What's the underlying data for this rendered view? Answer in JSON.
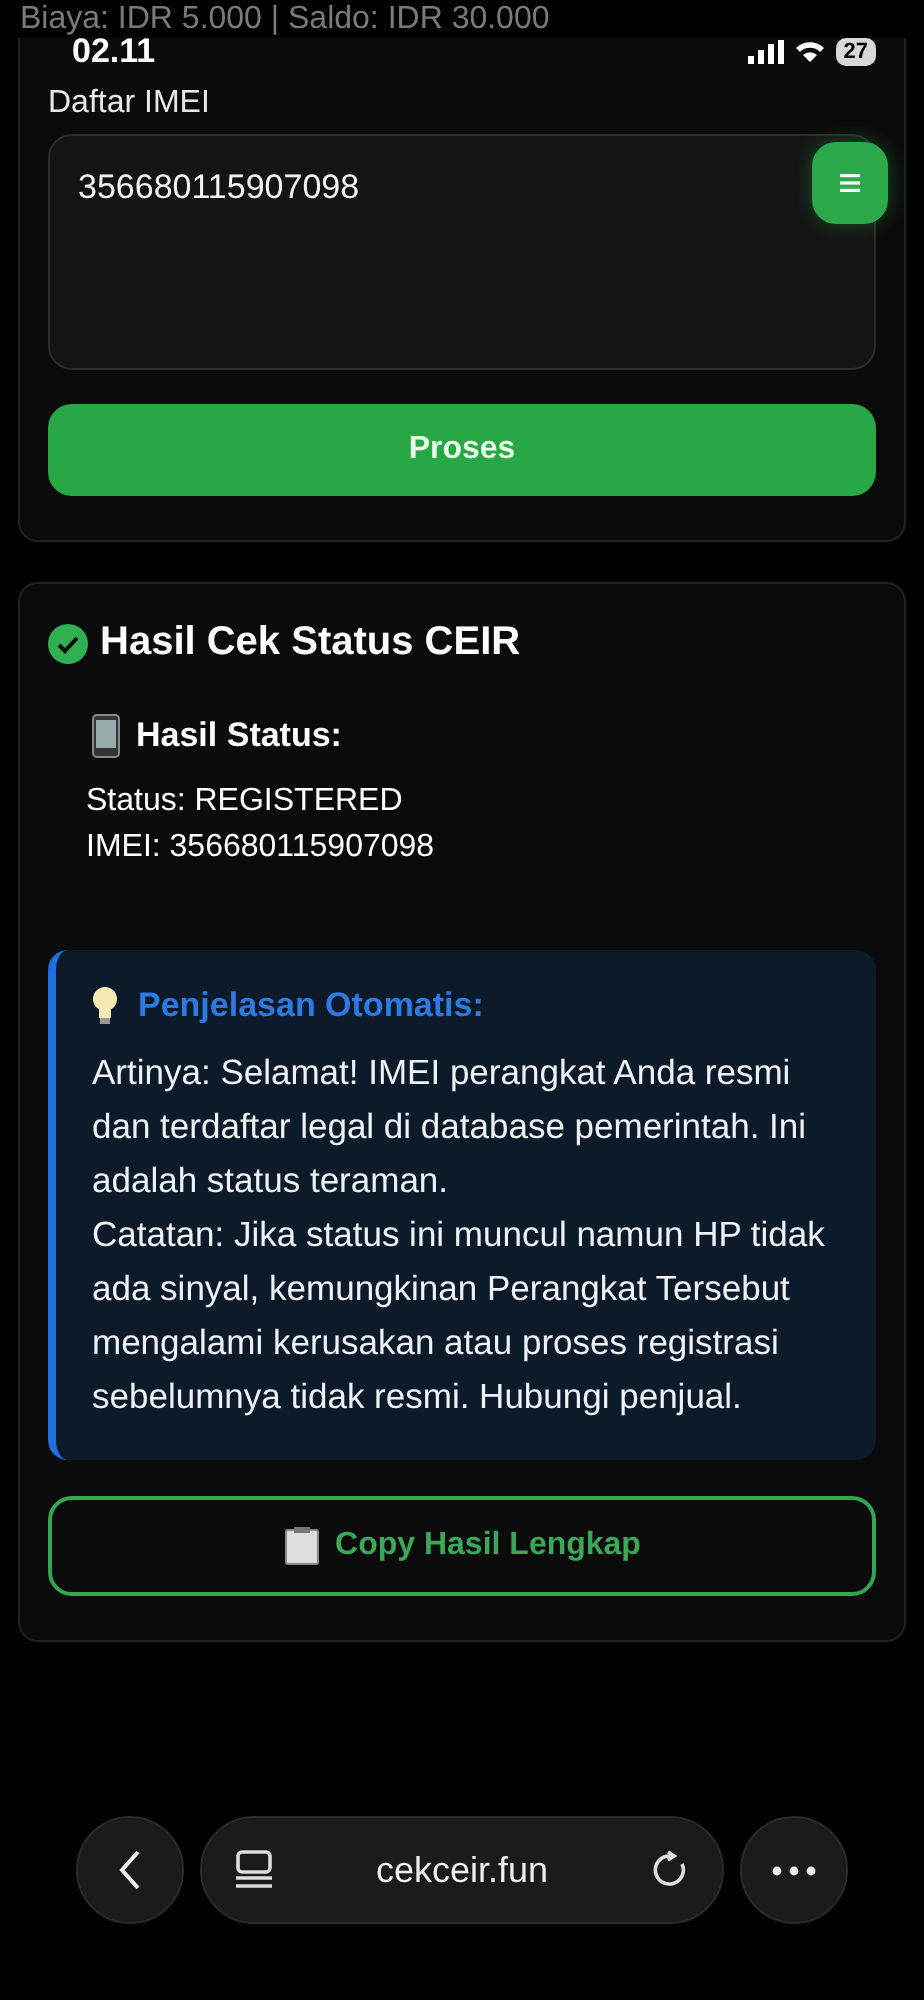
{
  "top_info": "Biaya: IDR 5.000 | Saldo: IDR 30.000",
  "status_bar": {
    "time": "02.11",
    "battery": "27"
  },
  "input_card": {
    "label": "Daftar IMEI",
    "value": "356680115907098",
    "button": "Proses"
  },
  "result_card": {
    "title": "Hasil Cek Status CEIR",
    "subtitle": "Hasil Status:",
    "lines": [
      "Status: REGISTERED",
      "IMEI: 356680115907098"
    ],
    "explanation": {
      "title": "Penjelasan Otomatis:",
      "paragraphs": [
        "Artinya: Selamat! IMEI perangkat Anda resmi dan terdaftar legal di database pemerintah. Ini adalah status teraman.",
        "Catatan: Jika status ini muncul namun HP tidak ada sinyal, kemungkinan Perangkat Tersebut mengalami kerusakan atau proses registrasi sebelumnya tidak resmi. Hubungi penjual."
      ]
    },
    "copy_button": "Copy Hasil Lengkap"
  },
  "browser_bar": {
    "url": "cekceir.fun"
  }
}
